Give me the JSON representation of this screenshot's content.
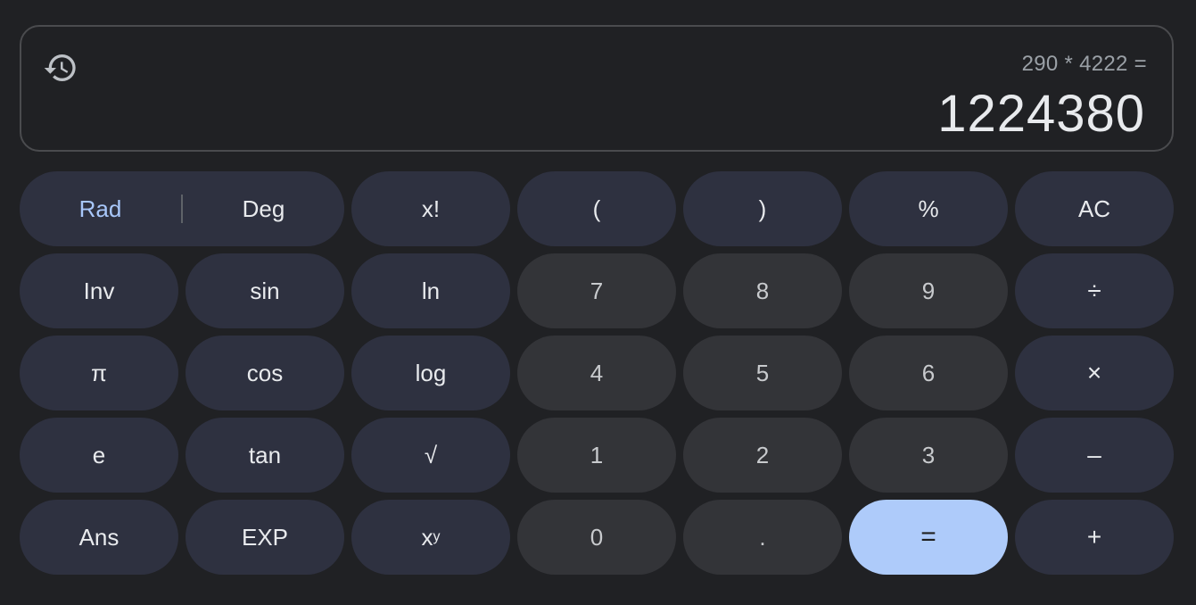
{
  "display": {
    "history_icon": "history-icon",
    "expression": "290 * 4222 =",
    "result": "1224380"
  },
  "keys": {
    "rad": "Rad",
    "deg": "Deg",
    "factorial": "x!",
    "open_paren": "(",
    "close_paren": ")",
    "percent": "%",
    "clear": "AC",
    "inv": "Inv",
    "sin": "sin",
    "ln": "ln",
    "seven": "7",
    "eight": "8",
    "nine": "9",
    "divide": "÷",
    "pi": "π",
    "cos": "cos",
    "log": "log",
    "four": "4",
    "five": "5",
    "six": "6",
    "multiply": "×",
    "e": "e",
    "tan": "tan",
    "sqrt": "√",
    "one": "1",
    "two": "2",
    "three": "3",
    "minus": "–",
    "ans": "Ans",
    "exp": "EXP",
    "power_base": "x",
    "power_exp": "y",
    "zero": "0",
    "decimal": ".",
    "equals": "=",
    "plus": "+"
  },
  "colors": {
    "background": "#202124",
    "function_key": "#2e3140",
    "number_key": "#333438",
    "equals_key": "#aecbfa",
    "active_mode": "#a8c7fa"
  }
}
